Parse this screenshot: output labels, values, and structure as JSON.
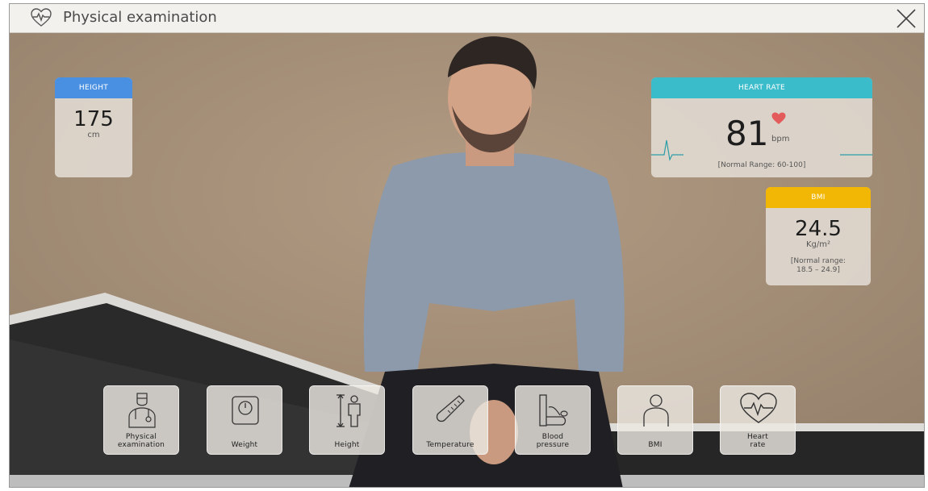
{
  "window": {
    "title": "Physical examination",
    "title_icon": "heart-pulse-icon",
    "close_icon": "close-icon"
  },
  "cards": {
    "height": {
      "header": "HEIGHT",
      "value": "175",
      "unit": "cm",
      "color": "#4a90e2"
    },
    "heart_rate": {
      "header": "HEART RATE",
      "value": "81",
      "unit": "bpm",
      "note": "[Normal Range: 60-100]",
      "color": "#3bbccb",
      "icon": "heart-icon"
    },
    "bmi": {
      "header": "BMI",
      "value": "24.5",
      "unit": "Kg/m²",
      "note_line1": "[Normal range:",
      "note_line2": "18.5 – 24.9]",
      "color": "#f2b705"
    }
  },
  "toolbar": {
    "items": [
      {
        "label_line1": "Physical",
        "label_line2": "examination",
        "icon": "doctor-icon"
      },
      {
        "label_line1": "Weight",
        "label_line2": "",
        "icon": "scale-icon"
      },
      {
        "label_line1": "Height",
        "label_line2": "",
        "icon": "height-measure-icon"
      },
      {
        "label_line1": "Temperature",
        "label_line2": "",
        "icon": "thermometer-icon"
      },
      {
        "label_line1": "Blood",
        "label_line2": "pressure",
        "icon": "blood-pressure-icon"
      },
      {
        "label_line1": "BMI",
        "label_line2": "",
        "icon": "person-icon"
      },
      {
        "label_line1": "Heart",
        "label_line2": "rate",
        "icon": "heart-pulse-icon"
      }
    ]
  }
}
